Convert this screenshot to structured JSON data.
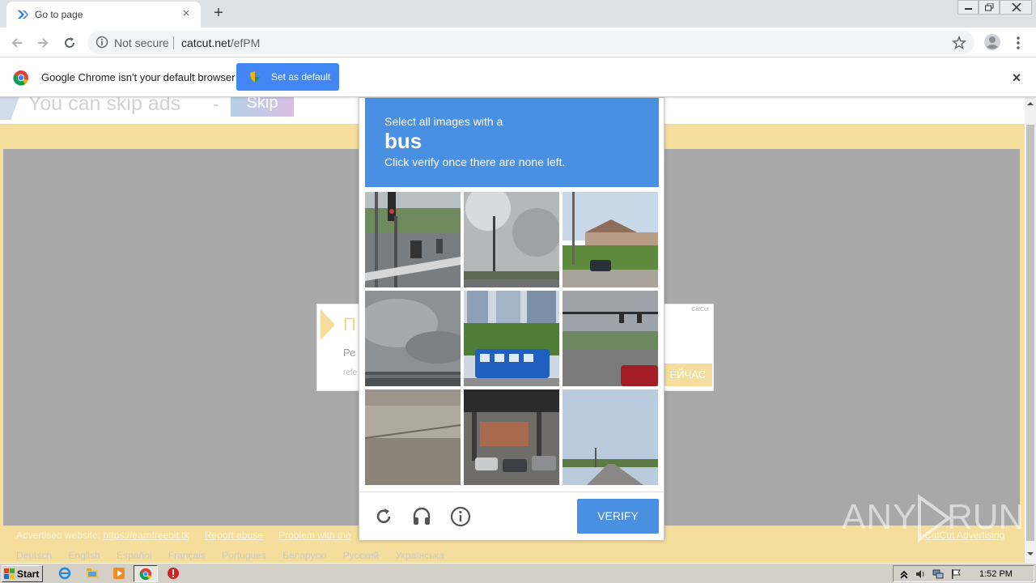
{
  "browser": {
    "tab_title": "Go to page",
    "new_tab": "+",
    "tab_close": "×",
    "security_label": "Not secure",
    "url_host": "catcut.net",
    "url_path": "/efPM"
  },
  "infobar": {
    "message": "Google Chrome isn't your default browser",
    "button_label": "Set as default",
    "close": "×"
  },
  "page": {
    "skip_text": "You can skip ads",
    "skip_dash": "-",
    "skip_button": "Skip",
    "ad": {
      "title": "П",
      "line1": "Ре",
      "line2": "refe",
      "brand": "CatCut",
      "cta": "ЕЙЧАС"
    },
    "footer": {
      "advertised_label": "Advertised website:",
      "advertised_link": "https://earnfreebit.tk",
      "report": "Report abuse",
      "problem": "Problem with the",
      "advertising": "CatCut Advertising"
    },
    "languages": [
      "Deutsch",
      "English",
      "Español",
      "Français",
      "Portugues",
      "Беларускі",
      "Русский",
      "Українська"
    ]
  },
  "captcha": {
    "instruction": "Select all images with a",
    "target": "bus",
    "instruction2": "Click verify once there are none left.",
    "verify_label": "VERIFY",
    "tiles": [
      "traffic light intersection",
      "overcast sky with pole",
      "suburban street with houses",
      "grey cloudy sky",
      "blue trolley bus",
      "street with traffic lights",
      "concrete wall",
      "parking under overpass",
      "open road"
    ]
  },
  "watermark": {
    "text_left": "ANY",
    "text_right": "RUN"
  },
  "taskbar": {
    "start_label": "Start",
    "clock": "1:52 PM"
  },
  "colors": {
    "captcha_blue": "#4a90e2",
    "infobar_button": "#4285f4",
    "page_gold": "#f5dd9b",
    "overlay_grey": "#a8a8a8"
  }
}
